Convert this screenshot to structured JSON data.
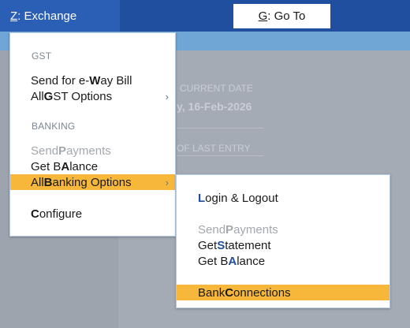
{
  "topbar": {
    "exchange_key": "Z",
    "exchange_label": ": Exchange",
    "goto_key": "G",
    "goto_label": ": Go To"
  },
  "background": {
    "current_date_label": "CURRENT DATE",
    "current_date_value": "y, 16-Feb-2026",
    "last_entry_label": "OF LAST ENTRY"
  },
  "exchange_menu": {
    "gst_section": "GST",
    "eway_pre": "Send for e-",
    "eway_key": "W",
    "eway_post": "ay Bill",
    "gst_all_pre": "All ",
    "gst_all_key": "G",
    "gst_all_post": "ST Options",
    "banking_section": "BANKING",
    "send_pay_pre": "Send ",
    "send_pay_key": "P",
    "send_pay_post": "ayments",
    "get_bal_pre": "Get B",
    "get_bal_key": "A",
    "get_bal_post": "lance",
    "all_bank_pre": "All ",
    "all_bank_key": "B",
    "all_bank_post": "anking Options",
    "configure_key": "C",
    "configure_post": "onfigure",
    "arrow": "›"
  },
  "banking_submenu": {
    "login_key": "L",
    "login_post": "ogin & Logout",
    "send_pay_pre": "Send ",
    "send_pay_key": "P",
    "send_pay_post": "ayments",
    "statement_pre": "Get ",
    "statement_key": "S",
    "statement_post": "tatement",
    "balance_pre": "Get B",
    "balance_key": "A",
    "balance_post": "lance",
    "bank_conn_pre": "Bank ",
    "bank_conn_key": "C",
    "bank_conn_post": "onnections"
  }
}
